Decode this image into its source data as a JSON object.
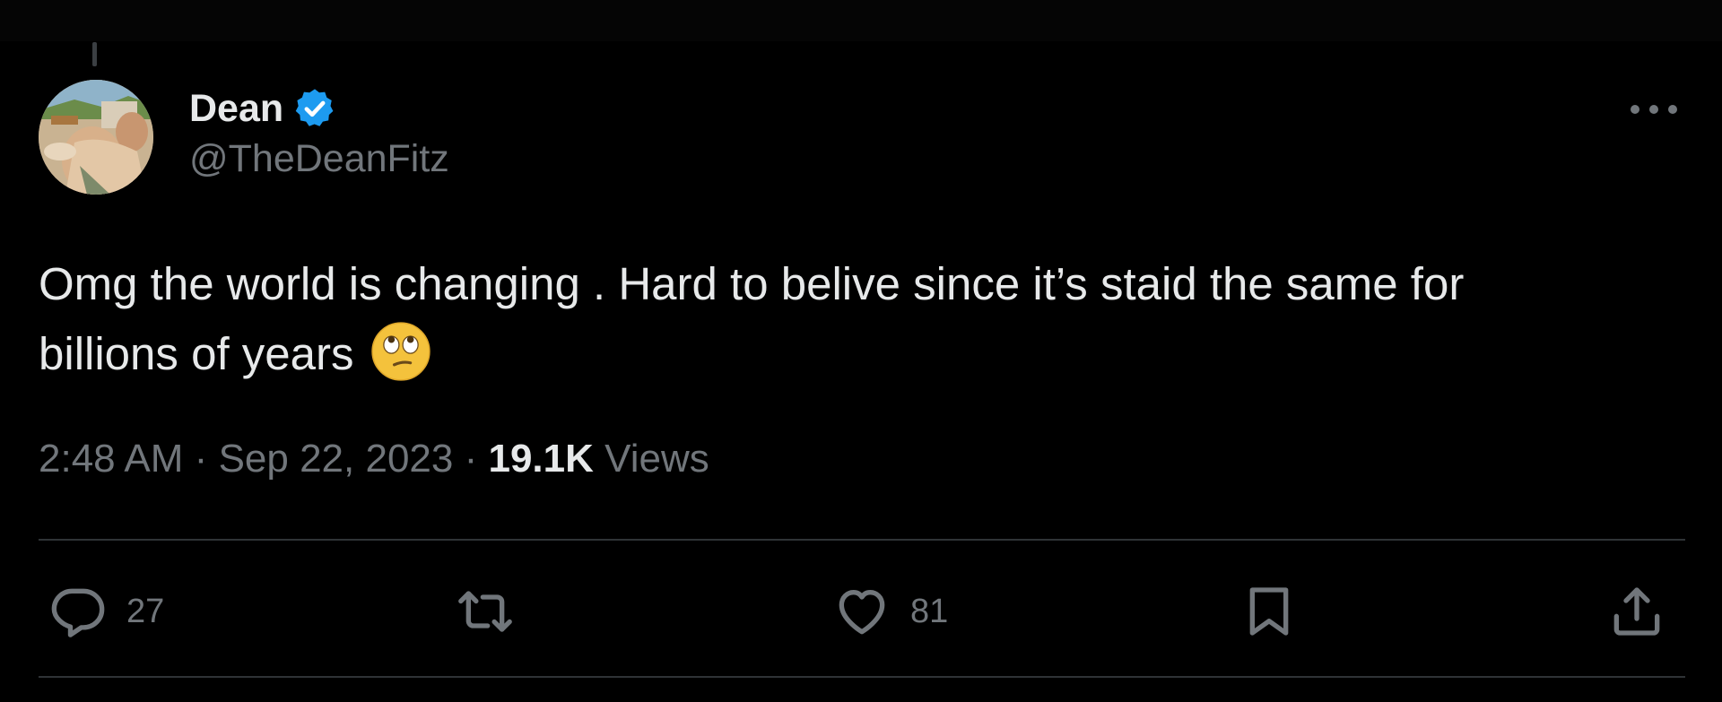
{
  "author": {
    "display_name": "Dean",
    "handle": "@TheDeanFitz",
    "verified": true,
    "avatar_icon": "user-avatar-photo"
  },
  "tweet": {
    "text_line1": "Omg the world is changing . Hard to belive since it’s staid the same for",
    "text_line2": "billions of years",
    "emoji": "face-with-rolling-eyes"
  },
  "meta": {
    "time": "2:48 AM",
    "separator": "·",
    "date": "Sep 22, 2023",
    "views_count": "19.1K",
    "views_label": "Views"
  },
  "actions": {
    "replies": "27",
    "likes": "81",
    "reply_icon": "reply-icon",
    "retweet_icon": "retweet-icon",
    "like_icon": "heart-icon",
    "bookmark_icon": "bookmark-icon",
    "share_icon": "share-icon"
  },
  "colors": {
    "background": "#000000",
    "text_primary": "#e7e9ea",
    "text_secondary": "#71767b",
    "verified_blue": "#1d9bf0",
    "divider": "#2f3336"
  }
}
